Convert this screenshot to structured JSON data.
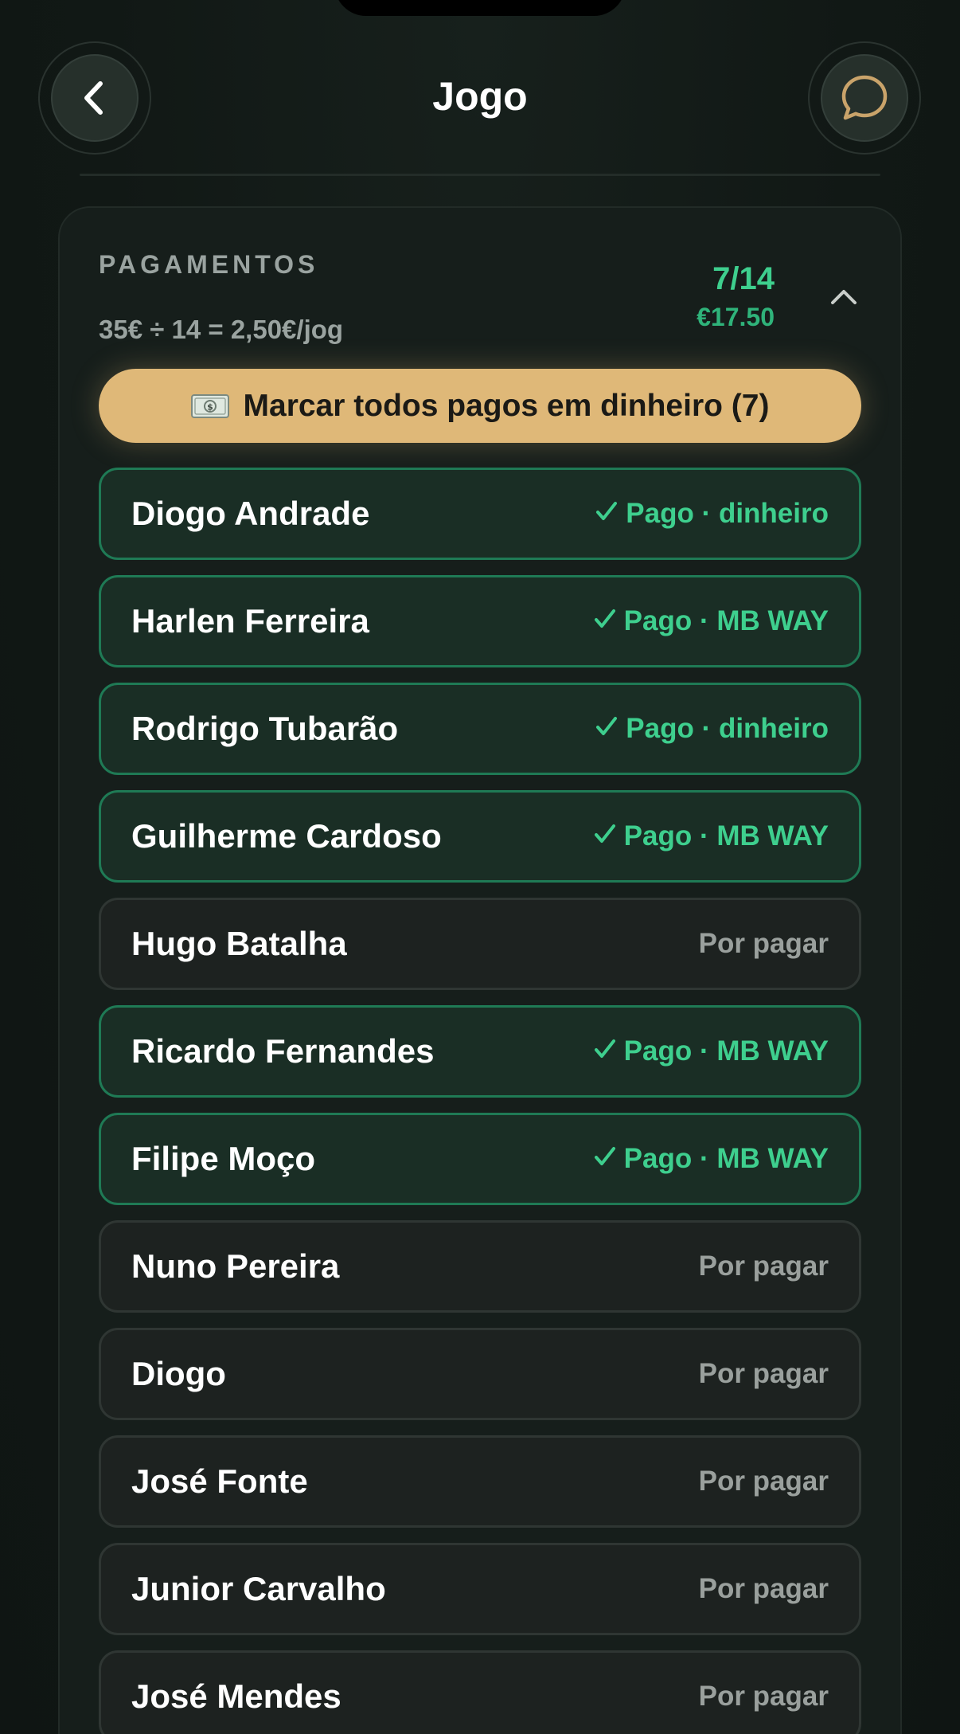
{
  "header": {
    "title": "Jogo",
    "back_icon": "chevron-left-icon",
    "chat_icon": "chat-bubble-icon"
  },
  "payments": {
    "section_label": "PAGAMENTOS",
    "formula": "35€ ÷ 14 = 2,50€/jog",
    "count": "7/14",
    "amount": "€17.50",
    "toggle_icon": "chevron-up-icon",
    "cash_button_label": "Marcar todos pagos em dinheiro (7)",
    "cash_button_icon": "money-icon"
  },
  "players": [
    {
      "name": "Diogo Andrade",
      "status": "Pago · dinheiro",
      "paid": true
    },
    {
      "name": "Harlen Ferreira",
      "status": "Pago · MB WAY",
      "paid": true
    },
    {
      "name": "Rodrigo Tubarão",
      "status": "Pago · dinheiro",
      "paid": true
    },
    {
      "name": "Guilherme Cardoso",
      "status": "Pago · MB WAY",
      "paid": true
    },
    {
      "name": "Hugo Batalha",
      "status": "Por pagar",
      "paid": false
    },
    {
      "name": "Ricardo Fernandes",
      "status": "Pago · MB WAY",
      "paid": true
    },
    {
      "name": "Filipe Moço",
      "status": "Pago · MB WAY",
      "paid": true
    },
    {
      "name": "Nuno Pereira",
      "status": "Por pagar",
      "paid": false
    },
    {
      "name": "Diogo",
      "status": "Por pagar",
      "paid": false
    },
    {
      "name": "José Fonte",
      "status": "Por pagar",
      "paid": false
    },
    {
      "name": "Junior Carvalho",
      "status": "Por pagar",
      "paid": false
    },
    {
      "name": "José Mendes",
      "status": "Por pagar",
      "paid": false
    }
  ],
  "colors": {
    "background": "#111815",
    "accent_green": "#3ecf8e",
    "cash_button": "#dfb878",
    "chat_icon": "#c9a36a"
  }
}
